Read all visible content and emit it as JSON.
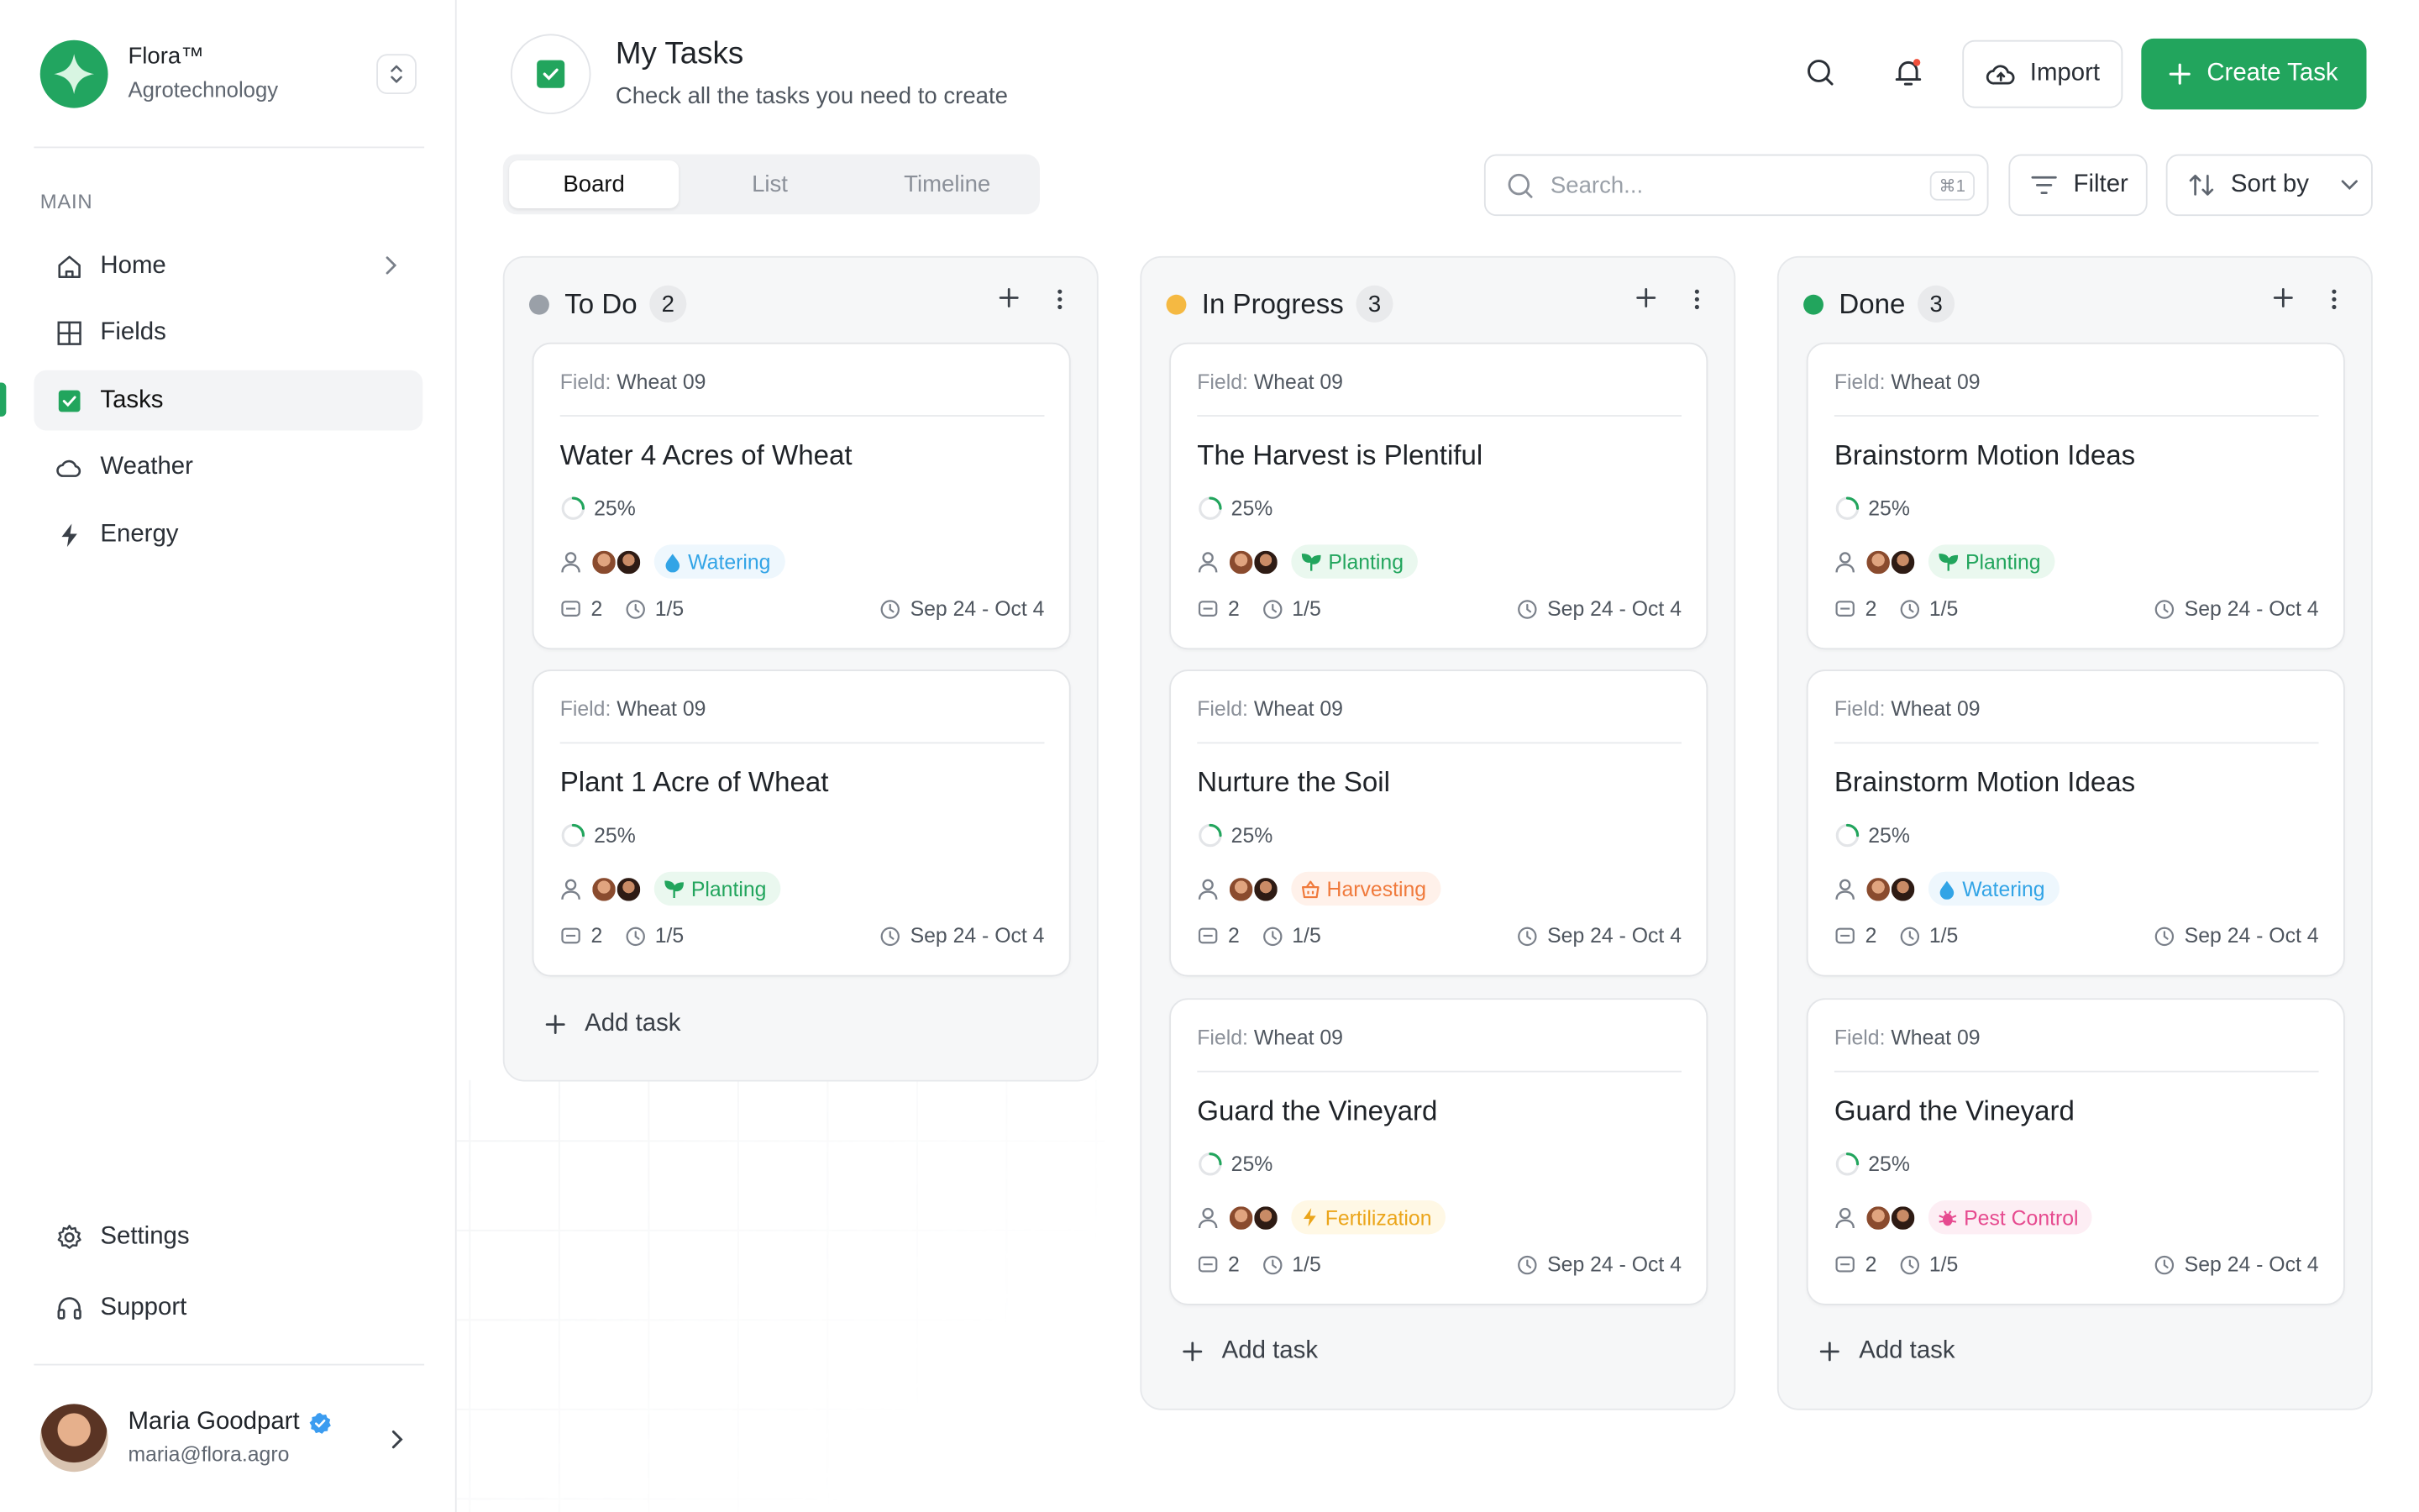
{
  "brand": {
    "name": "Flora™",
    "subtitle": "Agrotechnology"
  },
  "sidebar": {
    "section_label": "MAIN",
    "items": [
      {
        "label": "Home",
        "icon": "home-icon"
      },
      {
        "label": "Fields",
        "icon": "grid-icon"
      },
      {
        "label": "Tasks",
        "icon": "checkbox-icon",
        "active": true
      },
      {
        "label": "Weather",
        "icon": "cloud-icon"
      },
      {
        "label": "Energy",
        "icon": "bolt-icon"
      }
    ],
    "bottom_items": [
      {
        "label": "Settings",
        "icon": "gear-icon"
      },
      {
        "label": "Support",
        "icon": "headset-icon"
      }
    ],
    "user": {
      "name": "Maria Goodpart",
      "email": "maria@flora.agro"
    }
  },
  "header": {
    "title": "My Tasks",
    "subtitle": "Check all the tasks you need to create",
    "import_label": "Import",
    "create_label": "Create Task"
  },
  "tabs": [
    {
      "label": "Board",
      "active": true
    },
    {
      "label": "List"
    },
    {
      "label": "Timeline"
    }
  ],
  "toolbar": {
    "search_placeholder": "Search...",
    "search_shortcut": "⌘1",
    "filter_label": "Filter",
    "sort_label": "Sort by"
  },
  "colors": {
    "accent": "#22a55d",
    "todo": "#9aa0a8",
    "in_progress": "#f5b942",
    "done": "#22a55d"
  },
  "columns": [
    {
      "title": "To Do",
      "count": "2",
      "cards": [
        {
          "field_key": "Field:",
          "field": "Wheat 09",
          "title": "Water 4 Acres of Wheat",
          "progress": "25%",
          "tag": "Watering",
          "comments": "2",
          "subtasks": "1/5",
          "date": "Sep 24 - Oct 4"
        },
        {
          "field_key": "Field:",
          "field": "Wheat 09",
          "title": "Plant 1 Acre of Wheat",
          "progress": "25%",
          "tag": "Planting",
          "comments": "2",
          "subtasks": "1/5",
          "date": "Sep 24 - Oct 4"
        }
      ],
      "add_label": "Add task"
    },
    {
      "title": "In Progress",
      "count": "3",
      "cards": [
        {
          "field_key": "Field:",
          "field": "Wheat 09",
          "title": "The Harvest is Plentiful",
          "progress": "25%",
          "tag": "Planting",
          "comments": "2",
          "subtasks": "1/5",
          "date": "Sep 24 - Oct 4"
        },
        {
          "field_key": "Field:",
          "field": "Wheat 09",
          "title": "Nurture the Soil",
          "progress": "25%",
          "tag": "Harvesting",
          "comments": "2",
          "subtasks": "1/5",
          "date": "Sep 24 - Oct 4"
        },
        {
          "field_key": "Field:",
          "field": "Wheat 09",
          "title": "Guard the Vineyard",
          "progress": "25%",
          "tag": "Fertilization",
          "comments": "2",
          "subtasks": "1/5",
          "date": "Sep 24 - Oct 4"
        }
      ],
      "add_label": "Add task"
    },
    {
      "title": "Done",
      "count": "3",
      "cards": [
        {
          "field_key": "Field:",
          "field": "Wheat 09",
          "title": "Brainstorm Motion Ideas",
          "progress": "25%",
          "tag": "Planting",
          "comments": "2",
          "subtasks": "1/5",
          "date": "Sep 24 - Oct 4"
        },
        {
          "field_key": "Field:",
          "field": "Wheat 09",
          "title": "Brainstorm Motion Ideas",
          "progress": "25%",
          "tag": "Watering",
          "comments": "2",
          "subtasks": "1/5",
          "date": "Sep 24 - Oct 4"
        },
        {
          "field_key": "Field:",
          "field": "Wheat 09",
          "title": "Guard the Vineyard",
          "progress": "25%",
          "tag": "Pest Control",
          "comments": "2",
          "subtasks": "1/5",
          "date": "Sep 24 - Oct 4"
        }
      ],
      "add_label": "Add task"
    }
  ]
}
